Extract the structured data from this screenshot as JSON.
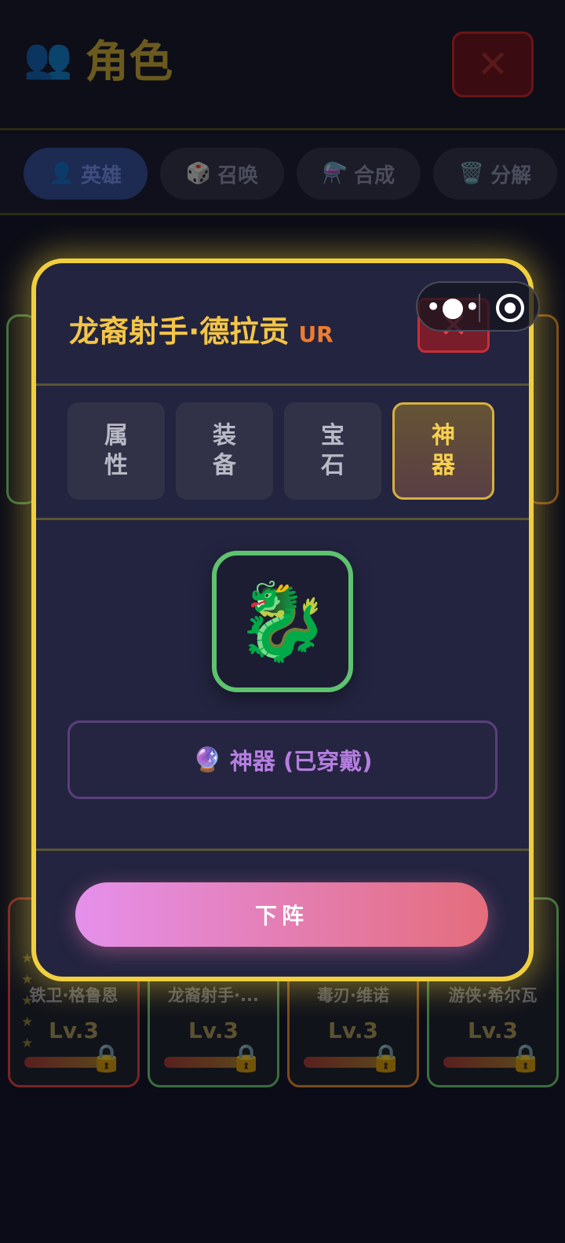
{
  "background": {
    "title": "角色",
    "tabs": [
      {
        "label": "英雄",
        "icon": "👤",
        "active": true
      },
      {
        "label": "召唤",
        "icon": "🎲",
        "active": false
      },
      {
        "label": "合成",
        "icon": "⚗️",
        "active": false
      },
      {
        "label": "分解",
        "icon": "🗑️",
        "active": false
      }
    ],
    "cards": [
      {
        "name": "铁卫·格鲁恩",
        "level": "Lv.3"
      },
      {
        "name": "龙裔射手·...",
        "level": "Lv.3"
      },
      {
        "name": "毒刃·维诺",
        "level": "Lv.3"
      },
      {
        "name": "游侠·希尔瓦",
        "level": "Lv.3"
      }
    ]
  },
  "modal": {
    "title": "龙裔射手·德拉贡",
    "rarity": "UR",
    "close_label": "✕",
    "tabs": [
      {
        "label": "属性",
        "active": false
      },
      {
        "label": "装备",
        "active": false
      },
      {
        "label": "宝石",
        "active": false
      },
      {
        "label": "神器",
        "active": true
      }
    ],
    "artifact_icon": "🐉",
    "equipped_icon": "🔮",
    "equipped_label": "神器 (已穿戴)",
    "dismiss_label": "下阵"
  },
  "colors": {
    "accent_gold": "#f0cf3e",
    "rarity": "#ef7b2e",
    "artifact_frame": "#5ec26f",
    "equipped_text": "#b57ee0",
    "button_gradient_start": "#e590ec",
    "button_gradient_end": "#e46d7c"
  }
}
